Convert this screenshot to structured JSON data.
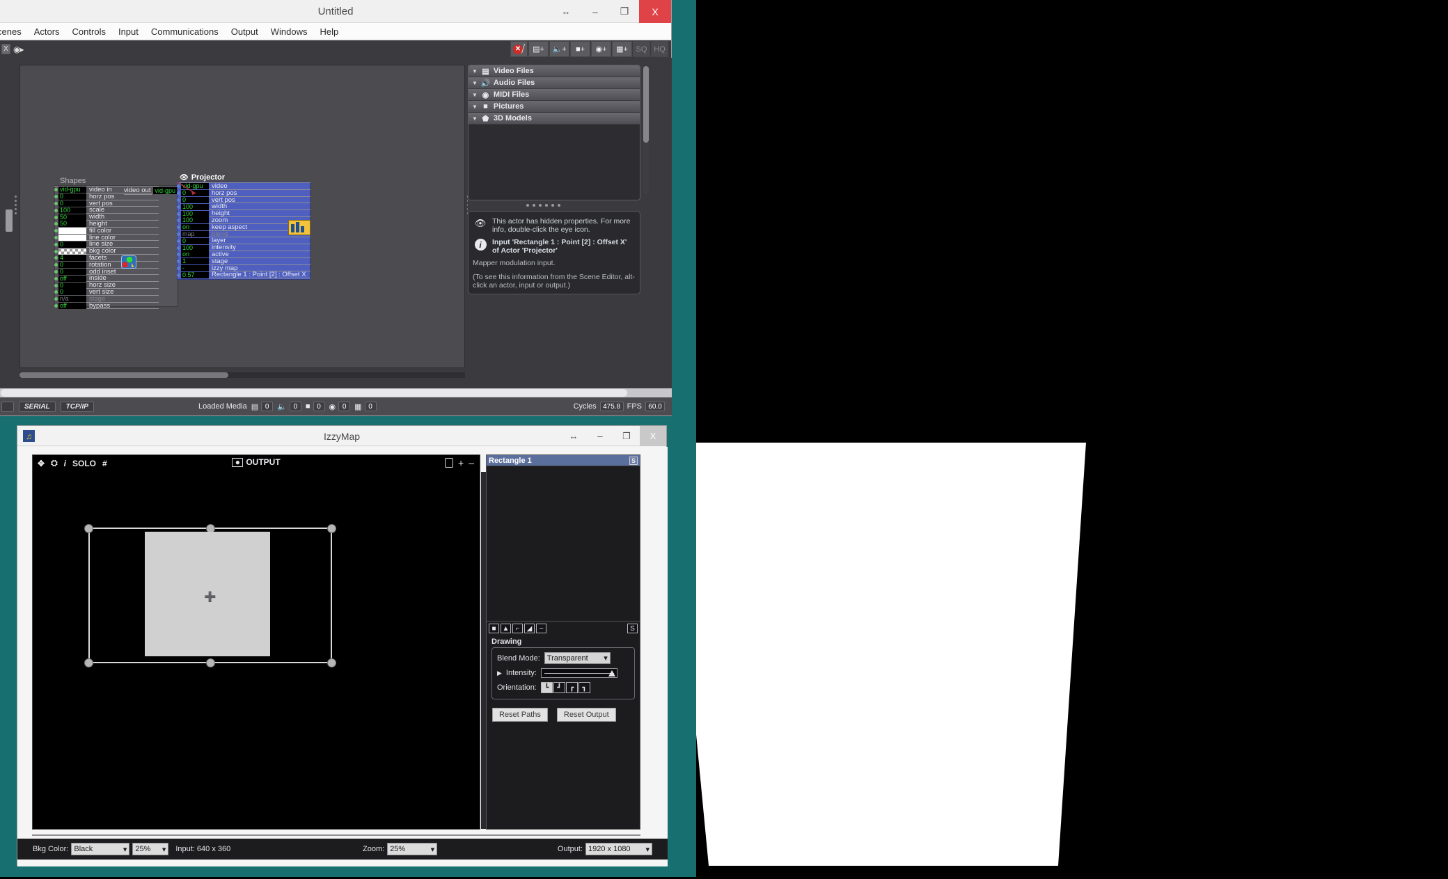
{
  "isadora": {
    "title": "Untitled",
    "window_buttons": {
      "resize": "↔",
      "minimize": "–",
      "maximize": "❐",
      "close": "X"
    },
    "menu": [
      "cenes",
      "Actors",
      "Controls",
      "Input",
      "Communications",
      "Output",
      "Windows",
      "Help"
    ],
    "toolbar": {
      "x_button": "X",
      "camera_icon": "camera-icon",
      "buttons": [
        "✕",
        "⫽",
        "▤+",
        "◂)+",
        "■+",
        "⚇+",
        "◱+",
        "SQ",
        "HQ"
      ],
      "sq_label": "SQ",
      "hq_label": "HQ"
    },
    "actors": {
      "shapes": {
        "name": "Shapes",
        "video_out_label": "video out",
        "video_out_value": "vid-gpu",
        "params": [
          {
            "value": "vid-gpu",
            "label": "video in",
            "type": "text"
          },
          {
            "value": "0",
            "label": "horz pos",
            "type": "num"
          },
          {
            "value": "0",
            "label": "vert pos",
            "type": "num"
          },
          {
            "value": "100",
            "label": "scale",
            "type": "num"
          },
          {
            "value": "50",
            "label": "width",
            "type": "num"
          },
          {
            "value": "50",
            "label": "height",
            "type": "num"
          },
          {
            "value": "",
            "label": "fill color",
            "type": "swatch"
          },
          {
            "value": "",
            "label": "line color",
            "type": "swatch"
          },
          {
            "value": "0",
            "label": "line size",
            "type": "num"
          },
          {
            "value": "",
            "label": "bkg color",
            "type": "checker"
          },
          {
            "value": "4",
            "label": "facets",
            "type": "num"
          },
          {
            "value": "0",
            "label": "rotation",
            "type": "num"
          },
          {
            "value": "0",
            "label": "odd inset",
            "type": "num"
          },
          {
            "value": "off",
            "label": "inside",
            "type": "num"
          },
          {
            "value": "0",
            "label": "horz size",
            "type": "num"
          },
          {
            "value": "0",
            "label": "vert size",
            "type": "num"
          },
          {
            "value": "n/a",
            "label": "stage",
            "type": "dim"
          },
          {
            "value": "off",
            "label": "bypass",
            "type": "num"
          }
        ]
      },
      "projector": {
        "name": "Projector",
        "eye_icon": "eye-icon",
        "params": [
          {
            "value": "vid-gpu",
            "label": "video",
            "type": "text"
          },
          {
            "value": "0",
            "label": "horz pos",
            "type": "num"
          },
          {
            "value": "0",
            "label": "vert pos",
            "type": "num"
          },
          {
            "value": "100",
            "label": "width",
            "type": "num"
          },
          {
            "value": "100",
            "label": "height",
            "type": "num"
          },
          {
            "value": "100",
            "label": "zoom",
            "type": "num"
          },
          {
            "value": "on",
            "label": "keep aspect",
            "type": "num"
          },
          {
            "value": "map",
            "label": "blend",
            "type": "dim"
          },
          {
            "value": "0",
            "label": "layer",
            "type": "num"
          },
          {
            "value": "100",
            "label": "intensity",
            "type": "num"
          },
          {
            "value": "on",
            "label": "active",
            "type": "num"
          },
          {
            "value": "1",
            "label": "stage",
            "type": "num"
          },
          {
            "value": "-",
            "label": "izzy map",
            "type": "num"
          },
          {
            "value": "0.57",
            "label": "Rectangle 1 : Point [2] : Offset X",
            "type": "num"
          }
        ]
      }
    },
    "media_panel": {
      "rows": [
        {
          "icon": "film-icon",
          "label": "Video Files"
        },
        {
          "icon": "speaker-icon",
          "label": "Audio Files"
        },
        {
          "icon": "midi-icon",
          "label": "MIDI Files"
        },
        {
          "icon": "picture-icon",
          "label": "Pictures"
        },
        {
          "icon": "cube-icon",
          "label": "3D Models"
        }
      ]
    },
    "info_panel": {
      "eye_text": "This actor has hidden properties. For more info, double-click the eye icon.",
      "info_title": "Input 'Rectangle 1 : Point [2] : Offset X' of Actor 'Projector'",
      "info_sub": "Mapper modulation input.",
      "info_note": "(To see this information from the Scene Editor, alt-click an actor, input or output.)"
    },
    "statusbar": {
      "serial": "SERIAL",
      "tcpip": "TCP/IP",
      "loaded_media_label": "Loaded Media",
      "counts": [
        {
          "icon": "film-icon",
          "value": "0"
        },
        {
          "icon": "speaker-icon",
          "value": "0"
        },
        {
          "icon": "picture-icon",
          "value": "0"
        },
        {
          "icon": "midi-icon",
          "value": "0"
        },
        {
          "icon": "cube-icon",
          "value": "0"
        }
      ],
      "cycles_label": "Cycles",
      "cycles_value": "475.8",
      "fps_label": "FPS",
      "fps_value": "60.0"
    }
  },
  "izzymap": {
    "title": "IzzyMap",
    "window_buttons": {
      "resize": "↔",
      "minimize": "–",
      "maximize": "❐",
      "close": "X"
    },
    "canvas_toolbar": {
      "move_icon": "move-icon",
      "fit_icon": "fit-icon",
      "info_icon": "info-icon",
      "solo_label": "SOLO",
      "hash_label": "#",
      "output_label": "OUTPUT",
      "lock_icon": "lock-icon",
      "plus_label": "+",
      "minus_label": "–"
    },
    "side_panel": {
      "selected_shape": "Rectangle 1",
      "solo_badge": "S",
      "tools": [
        "square-tool",
        "triangle-tool",
        "bracket-tool",
        "freeform-tool",
        "line-tool"
      ],
      "tools_glyphs": [
        "■",
        "▲",
        "⌐",
        "◢",
        "–"
      ],
      "tools_solo": "S",
      "section_title": "Drawing",
      "blend_mode_label": "Blend Mode:",
      "blend_mode_value": "Transparent",
      "intensity_label": "Intensity:",
      "intensity_arrow": "▶",
      "orientation_label": "Orientation:",
      "orientation_options": [
        "┗",
        "┛",
        "┏",
        "┓"
      ],
      "reset_paths": "Reset Paths",
      "reset_output": "Reset Output"
    },
    "statusbar": {
      "bkg_color_label": "Bkg Color:",
      "bkg_color_value": "Black",
      "bkg_pct_value": "25%",
      "input_label": "Input: 640 x 360",
      "zoom_label": "Zoom:",
      "zoom_value": "25%",
      "output_label": "Output:",
      "output_value": "1920 x 1080"
    }
  },
  "colors": {
    "desktop_teal": "#17706f",
    "projector_blue": "#4e5fc0",
    "value_green": "#36d43a",
    "accent_red": "#cc2b28"
  }
}
